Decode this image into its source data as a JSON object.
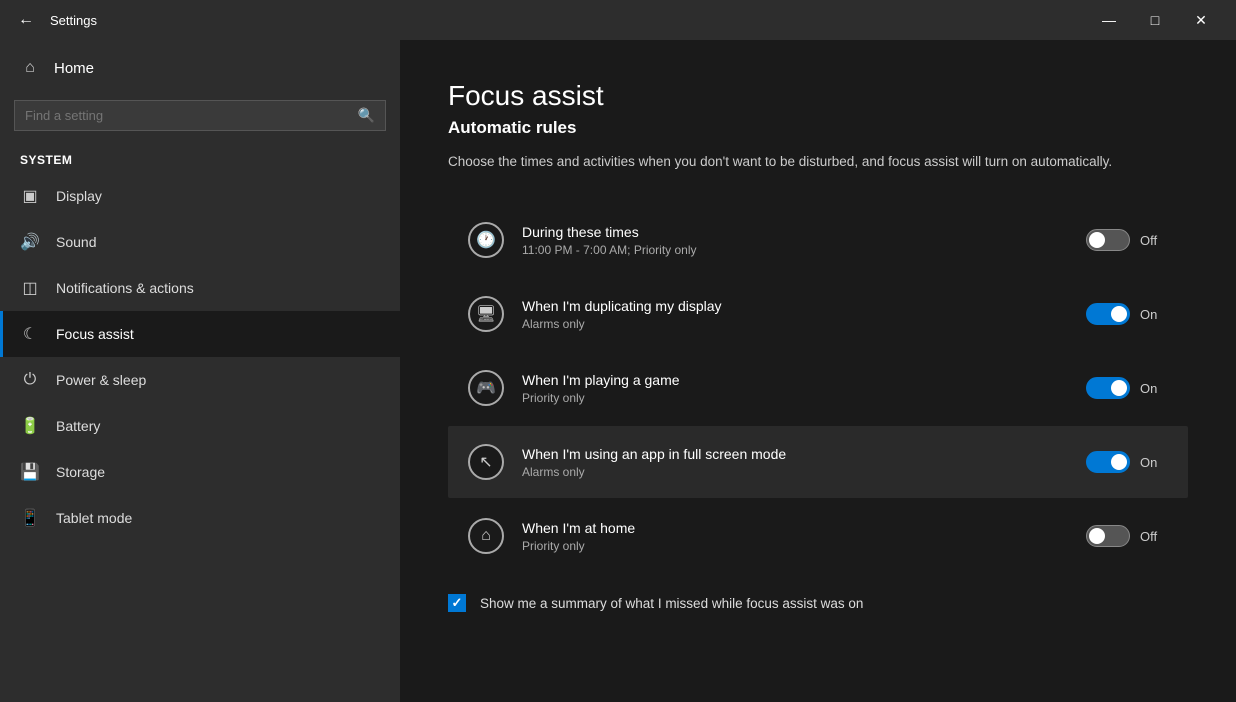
{
  "titlebar": {
    "title": "Settings",
    "minimize": "—",
    "maximize": "□",
    "close": "✕"
  },
  "sidebar": {
    "home_label": "Home",
    "search_placeholder": "Find a setting",
    "section_label": "System",
    "items": [
      {
        "id": "display",
        "label": "Display",
        "icon": "🖥"
      },
      {
        "id": "sound",
        "label": "Sound",
        "icon": "🔊"
      },
      {
        "id": "notifications",
        "label": "Notifications & actions",
        "icon": "🔔"
      },
      {
        "id": "focus",
        "label": "Focus assist",
        "icon": "🌙",
        "active": true
      },
      {
        "id": "power",
        "label": "Power & sleep",
        "icon": "⏻"
      },
      {
        "id": "battery",
        "label": "Battery",
        "icon": "🔋"
      },
      {
        "id": "storage",
        "label": "Storage",
        "icon": "💾"
      },
      {
        "id": "tablet",
        "label": "Tablet mode",
        "icon": "📱"
      }
    ]
  },
  "main": {
    "title": "Focus assist",
    "subtitle": "Automatic rules",
    "description": "Choose the times and activities when you don't want to be disturbed, and focus assist will turn on automatically.",
    "rules": [
      {
        "id": "during-times",
        "icon": "🕐",
        "title": "During these times",
        "subtitle": "11:00 PM - 7:00 AM; Priority only",
        "toggle": "off",
        "toggle_label": "Off"
      },
      {
        "id": "duplicating-display",
        "icon": "🖥",
        "title": "When I'm duplicating my display",
        "subtitle": "Alarms only",
        "toggle": "on",
        "toggle_label": "On"
      },
      {
        "id": "playing-game",
        "icon": "🎮",
        "title": "When I'm playing a game",
        "subtitle": "Priority only",
        "toggle": "on",
        "toggle_label": "On"
      },
      {
        "id": "full-screen",
        "icon": "⤢",
        "title": "When I'm using an app in full screen mode",
        "subtitle": "Alarms only",
        "toggle": "on",
        "toggle_label": "On",
        "highlighted": true
      },
      {
        "id": "at-home",
        "icon": "🏠",
        "title": "When I'm at home",
        "subtitle": "Priority only",
        "toggle": "off",
        "toggle_label": "Off"
      }
    ],
    "checkbox_label": "Show me a summary of what I missed while focus assist was on",
    "checkbox_checked": true
  }
}
